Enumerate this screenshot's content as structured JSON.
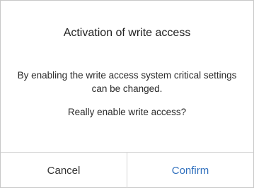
{
  "dialog": {
    "title": "Activation of write access",
    "message": "By enabling the write access system critical settings can be changed.",
    "question": "Really enable write access?",
    "cancel_label": "Cancel",
    "confirm_label": "Confirm"
  },
  "colors": {
    "confirm_text": "#2f6fbd",
    "cancel_text": "#333333",
    "border": "#d6d6d6"
  }
}
